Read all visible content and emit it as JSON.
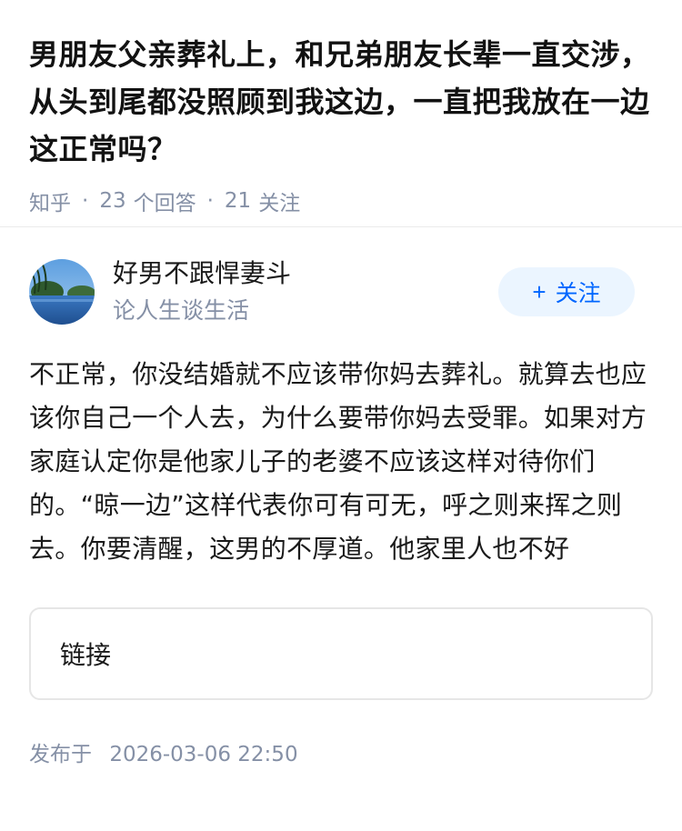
{
  "question": {
    "title": "男朋友父亲葬礼上，和兄弟朋友长辈一直交涉，从头到尾都没照顾到我这边，一直把我放在一边这正常吗？",
    "source": "知乎",
    "answer_count": "23",
    "answer_label": "个回答",
    "follower_count": "21",
    "follower_label": "关注"
  },
  "answer": {
    "author_name": "好男不跟悍妻斗",
    "author_bio": "论人生谈生活",
    "follow_label": "关注",
    "text": "不正常，你没结婚就不应该带你妈去葬礼。就算去也应该你自己一个人去，为什么要带你妈去受罪。如果对方家庭认定你是他家儿子的老婆不应该这样对待你们的。“晾一边”这样代表你可有可无，呼之则来挥之则去。你要清醒，这男的不厚道。他家里人也不好",
    "link_label": "链接",
    "publish_label": "发布于",
    "publish_time": "2026-03-06 22:50"
  }
}
